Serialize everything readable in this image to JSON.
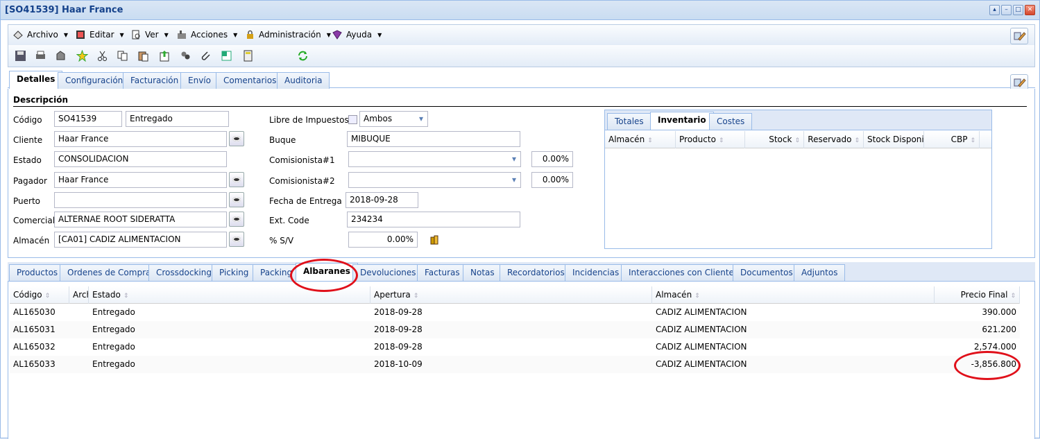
{
  "window": {
    "title": "[SO41539] Haar France"
  },
  "menu": [
    {
      "label": "Archivo",
      "icon": "archive-icon"
    },
    {
      "label": "Editar",
      "icon": "edit-icon"
    },
    {
      "label": "Ver",
      "icon": "view-icon"
    },
    {
      "label": "Acciones",
      "icon": "actions-icon"
    },
    {
      "label": "Administración",
      "icon": "lock-icon"
    },
    {
      "label": "Ayuda",
      "icon": "help-book-icon"
    }
  ],
  "main_tabs": [
    "Detalles",
    "Configuración",
    "Facturación",
    "Envío",
    "Comentarios",
    "Auditoria"
  ],
  "section_title": "Descripción",
  "form": {
    "codigo_label": "Código",
    "codigo": "SO41539",
    "estado_doc": "Entregado",
    "cliente_label": "Cliente",
    "cliente": "Haar France",
    "estado_label": "Estado",
    "estado": "CONSOLIDACION",
    "pagador_label": "Pagador",
    "pagador": "Haar France",
    "puerto_label": "Puerto",
    "puerto": "",
    "comercial_label": "Comercial",
    "comercial": "ALTERNAE ROOT SIDERATTA",
    "almacen_label": "Almacén",
    "almacen": "[CA01] CADIZ ALIMENTACION",
    "libre_label": "Libre de Impuestos",
    "libre_value": "Ambos",
    "buque_label": "Buque",
    "buque": "MIBUQUE",
    "comisionista1_label": "Comisionista#1",
    "comisionista1": "",
    "comisionista1_pct": "0.00%",
    "comisionista2_label": "Comisionista#2",
    "comisionista2": "",
    "comisionista2_pct": "0.00%",
    "fecha_label": "Fecha de Entrega",
    "fecha": "2018-09-28",
    "extcode_label": "Ext. Code",
    "extcode": "234234",
    "sv_label": "% S/V",
    "sv": "0.00%"
  },
  "inv_tabs": [
    "Totales",
    "Inventario",
    "Costes"
  ],
  "inv_columns": [
    "Almacén",
    "Producto",
    "Stock",
    "Reservado",
    "Stock Disponibl",
    "CBP"
  ],
  "bottom_tabs": [
    "Productos",
    "Ordenes de Compra",
    "Crossdocking",
    "Picking",
    "Packing",
    "Albaranes",
    "Devoluciones",
    "Facturas",
    "Notas",
    "Recordatorios",
    "Incidencias",
    "Interacciones con Clientes",
    "Documentos",
    "Adjuntos"
  ],
  "grid": {
    "columns": [
      "Código",
      "Arch",
      "Estado",
      "Apertura",
      "Almacén",
      "Precio Final"
    ],
    "rows": [
      {
        "codigo": "AL165030",
        "estado": "Entregado",
        "apertura": "2018-09-28",
        "almacen": "CADIZ ALIMENTACION",
        "precio": "390.000"
      },
      {
        "codigo": "AL165031",
        "estado": "Entregado",
        "apertura": "2018-09-28",
        "almacen": "CADIZ ALIMENTACION",
        "precio": "621.200"
      },
      {
        "codigo": "AL165032",
        "estado": "Entregado",
        "apertura": "2018-09-28",
        "almacen": "CADIZ ALIMENTACION",
        "precio": "2,574.000"
      },
      {
        "codigo": "AL165033",
        "estado": "Entregado",
        "apertura": "2018-10-09",
        "almacen": "CADIZ ALIMENTACION",
        "precio": "-3,856.800"
      }
    ]
  },
  "colors": {
    "accent": "#15428b",
    "border": "#99bbe8",
    "highlight": "#e0101a"
  }
}
